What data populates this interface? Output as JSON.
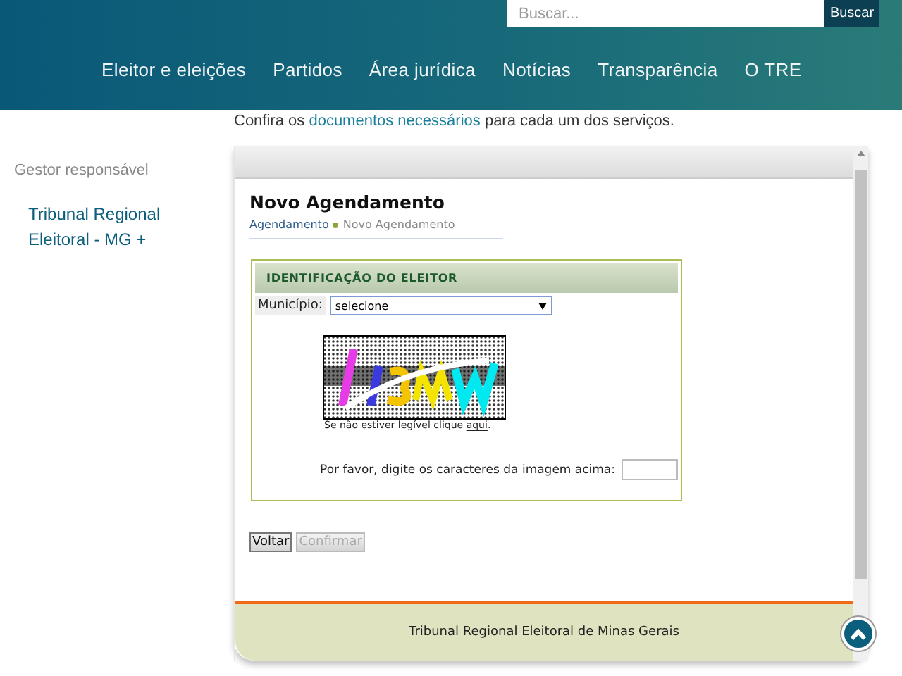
{
  "header": {
    "search": {
      "placeholder": "Buscar..."
    },
    "search_button": "Buscar",
    "nav": [
      "Eleitor e eleições",
      "Partidos",
      "Área jurídica",
      "Notícias",
      "Transparência",
      "O TRE"
    ]
  },
  "intro": {
    "before": "Confira os ",
    "link": "documentos necessários",
    "after": " para cada um dos serviços."
  },
  "sidebar": {
    "heading": "Gestor responsável",
    "link": "Tribunal Regional Eleitoral - MG +"
  },
  "form": {
    "title": "Novo Agendamento",
    "breadcrumb": [
      {
        "label": "Agendamento",
        "current": false
      },
      {
        "label": "Novo Agendamento",
        "current": true
      }
    ],
    "section": "IDENTIFICAÇÃO DO ELEITOR",
    "municipio": {
      "label": "Município:",
      "value": "selecione"
    },
    "captcha_hint": {
      "before": "Se não estiver legível clique ",
      "link": "aqui",
      "after": "."
    },
    "captcha_prompt": "Por favor, digite os caracteres da imagem acima:",
    "buttons": [
      {
        "label": "Voltar",
        "disabled": false
      },
      {
        "label": "Confirmar",
        "disabled": true
      }
    ]
  },
  "footer": "Tribunal Regional Eleitoral de Minas Gerais"
}
